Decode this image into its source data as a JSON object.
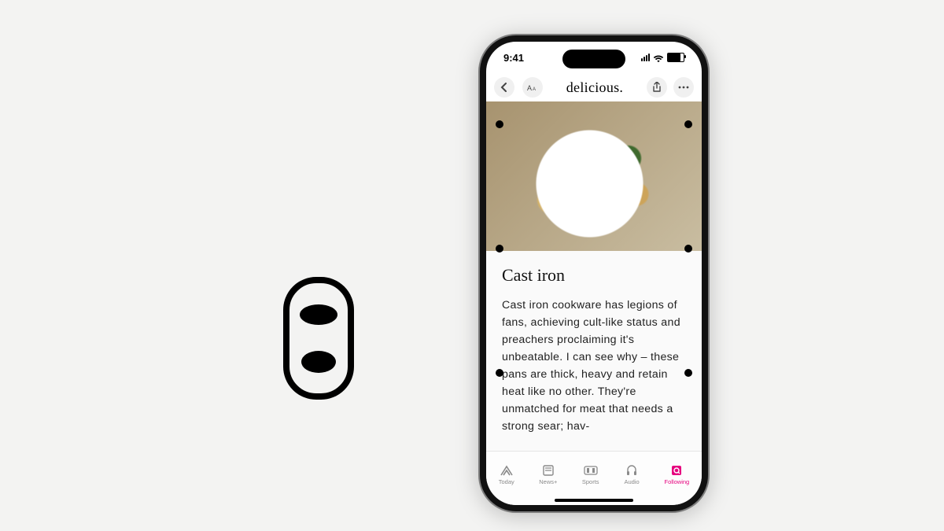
{
  "status": {
    "time": "9:41"
  },
  "nav": {
    "back_icon": "chevron-left",
    "appearance_icon": "text-size",
    "title": "delicious.",
    "share_icon": "share",
    "more_icon": "ellipsis"
  },
  "article": {
    "heading": "Cast iron",
    "body": "Cast iron cookware has legions of fans, achieving cult-like status and preachers proclaiming it's unbeatable. I can see why – these pans are thick, heavy and retain heat like no other. They're unmatched for meat that needs a strong sear; hav-"
  },
  "tabs": [
    {
      "label": "Today",
      "icon": "news-icon"
    },
    {
      "label": "News+",
      "icon": "newsplus-icon"
    },
    {
      "label": "Sports",
      "icon": "sports-icon"
    },
    {
      "label": "Audio",
      "icon": "audio-icon"
    },
    {
      "label": "Following",
      "icon": "following-icon"
    }
  ],
  "active_tab_index": 4,
  "colors": {
    "accent": "#e6007e"
  },
  "left_graphic": "car-top-view-icon"
}
